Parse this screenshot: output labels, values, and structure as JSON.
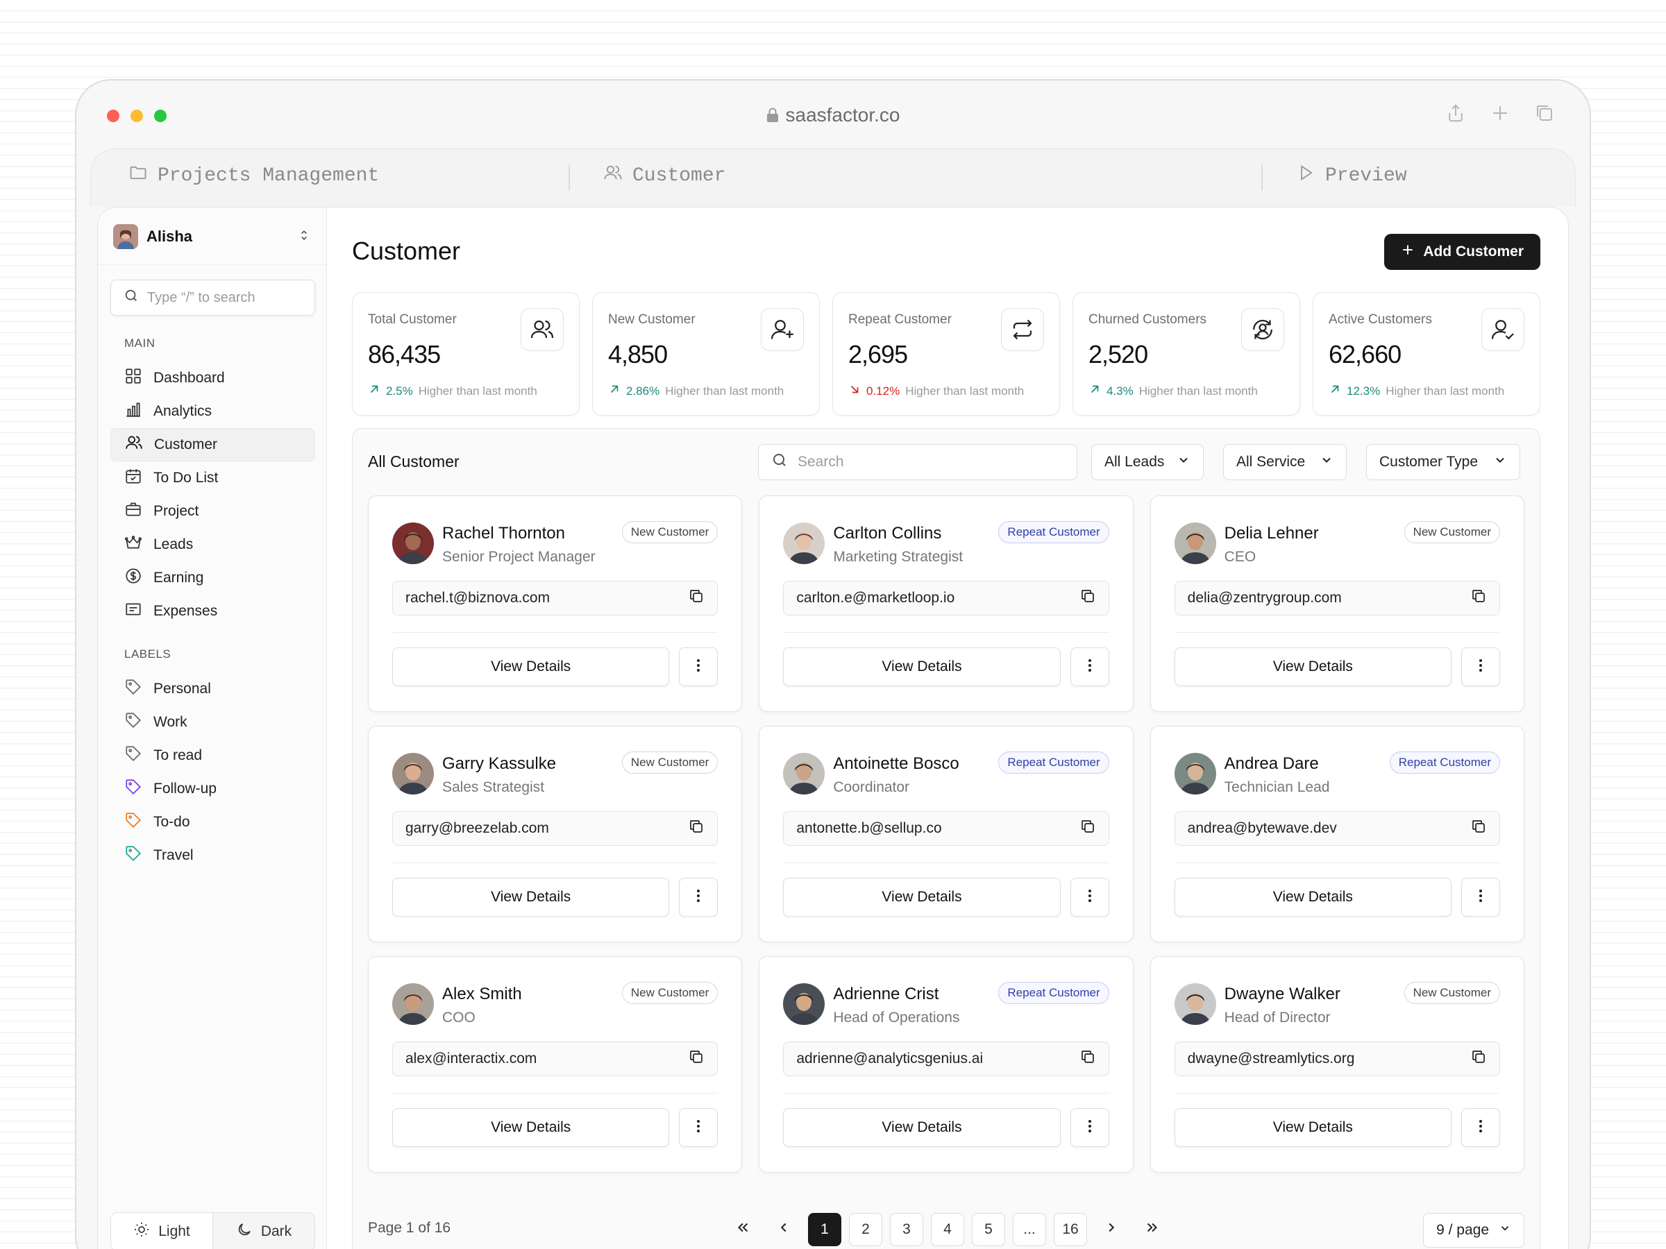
{
  "browser": {
    "url": "saasfactor.co",
    "tabs": [
      {
        "label": "Projects Management",
        "icon": "folder-icon"
      },
      {
        "label": "Customer",
        "icon": "users-icon"
      },
      {
        "label": "Preview",
        "icon": "play-icon"
      }
    ]
  },
  "sidebar": {
    "user_name": "Alisha",
    "search_placeholder": "Type “/” to search",
    "main_label": "MAIN",
    "main_items": [
      {
        "label": "Dashboard",
        "icon": "grid-icon"
      },
      {
        "label": "Analytics",
        "icon": "bar-chart-icon"
      },
      {
        "label": "Customer",
        "icon": "users-icon",
        "active": true
      },
      {
        "label": "To Do List",
        "icon": "calendar-check-icon"
      },
      {
        "label": "Project",
        "icon": "briefcase-icon"
      },
      {
        "label": "Leads",
        "icon": "crown-icon"
      },
      {
        "label": "Earning",
        "icon": "dollar-circle-icon"
      },
      {
        "label": "Expenses",
        "icon": "receipt-icon"
      }
    ],
    "labels_label": "LABELS",
    "label_items": [
      {
        "label": "Personal",
        "color": "#666666"
      },
      {
        "label": "Work",
        "color": "#666666"
      },
      {
        "label": "To read",
        "color": "#666666"
      },
      {
        "label": "Follow-up",
        "color": "#7c3aed"
      },
      {
        "label": "To-do",
        "color": "#ea7a1e"
      },
      {
        "label": "Travel",
        "color": "#1aa596"
      }
    ],
    "theme": {
      "light": "Light",
      "dark": "Dark"
    }
  },
  "header": {
    "title": "Customer",
    "add_button": "Add Customer"
  },
  "stats": [
    {
      "label": "Total Customer",
      "value": "86,435",
      "trend": "2.5%",
      "direction": "up",
      "note": "Higher than last month",
      "icon": "users-icon"
    },
    {
      "label": "New Customer",
      "value": "4,850",
      "trend": "2.86%",
      "direction": "up",
      "note": "Higher than last month",
      "icon": "user-plus-icon"
    },
    {
      "label": "Repeat Customer",
      "value": "2,695",
      "trend": "0.12%",
      "direction": "down",
      "note": "Higher than last month",
      "icon": "repeat-icon"
    },
    {
      "label": "Churned Customers",
      "value": "2,520",
      "trend": "4.3%",
      "direction": "up",
      "note": "Higher than last month",
      "icon": "user-cycle-icon"
    },
    {
      "label": "Active Customers",
      "value": "62,660",
      "trend": "12.3%",
      "direction": "up",
      "note": "Higher than last month",
      "icon": "user-check-icon"
    }
  ],
  "list": {
    "title": "All Customer",
    "search_placeholder": "Search",
    "filters": [
      "All Leads",
      "All Service",
      "Customer Type"
    ],
    "view_label": "View Details",
    "customers": [
      {
        "name": "Rachel Thornton",
        "role": "Senior Project Manager",
        "badge": "New Customer",
        "type": "new",
        "email": "rachel.t@biznova.com",
        "skin": "#a06a55",
        "hair": "#3a2418",
        "bg": "#7a2e2e"
      },
      {
        "name": "Carlton Collins",
        "role": "Marketing Strategist",
        "badge": "Repeat Customer",
        "type": "repeat",
        "email": "carlton.e@marketloop.io",
        "skin": "#e4c2a8",
        "hair": "#5a3b28",
        "bg": "#d8d0c8"
      },
      {
        "name": "Delia Lehner",
        "role": "CEO",
        "badge": "New Customer",
        "type": "new",
        "email": "delia@zentrygroup.com",
        "skin": "#c89878",
        "hair": "#2f241d",
        "bg": "#b8b8b0"
      },
      {
        "name": "Garry Kassulke",
        "role": "Sales Strategist",
        "badge": "New Customer",
        "type": "new",
        "email": "garry@breezelab.com",
        "skin": "#d9ae92",
        "hair": "#4a2f20",
        "bg": "#9c8b80"
      },
      {
        "name": "Antoinette Bosco",
        "role": "Coordinator",
        "badge": "Repeat Customer",
        "type": "repeat",
        "email": "antonette.b@sellup.co",
        "skin": "#c9a48a",
        "hair": "#2d2520",
        "bg": "#c4c0bb"
      },
      {
        "name": "Andrea Dare",
        "role": "Technician Lead",
        "badge": "Repeat Customer",
        "type": "repeat",
        "email": "andrea@bytewave.dev",
        "skin": "#d5b597",
        "hair": "#3b2c22",
        "bg": "#7b8a82"
      },
      {
        "name": "Alex Smith",
        "role": "COO",
        "badge": "New Customer",
        "type": "new",
        "email": "alex@interactix.com",
        "skin": "#c99c7d",
        "hair": "#3d2b20",
        "bg": "#a9a098"
      },
      {
        "name": "Adrienne Crist",
        "role": "Head of Operations",
        "badge": "Repeat Customer",
        "type": "repeat",
        "email": "adrienne@analyticsgenius.ai",
        "skin": "#d4a786",
        "hair": "#1f1915",
        "bg": "#4a4f57"
      },
      {
        "name": "Dwayne Walker",
        "role": "Head of Director",
        "badge": "New Customer",
        "type": "new",
        "email": "dwayne@streamlytics.org",
        "skin": "#d8b79c",
        "hair": "#1e1a17",
        "bg": "#c9c9c9"
      }
    ]
  },
  "pagination": {
    "info": "Page 1 of 16",
    "pages": [
      "1",
      "2",
      "3",
      "4",
      "5",
      "...",
      "16"
    ],
    "current": "1",
    "per_page": "9 / page"
  }
}
